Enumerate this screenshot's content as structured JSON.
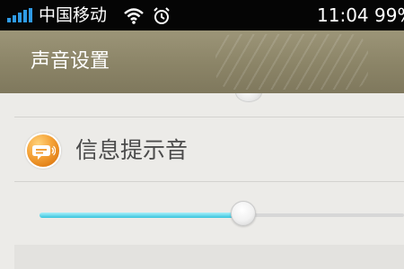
{
  "status_bar": {
    "carrier": "中国移动",
    "time": "11:04",
    "battery_percent": "99%",
    "signal_icon": "signal-bars-icon",
    "wifi_icon": "wifi-icon",
    "alarm_icon": "alarm-clock-icon"
  },
  "header": {
    "title": "声音设置"
  },
  "settings": {
    "message_tone": {
      "label": "信息提示音",
      "icon": "message-bubble-icon",
      "volume_fraction": 0.56
    }
  },
  "colors": {
    "status_bar_bg": "#050505",
    "header_bg": "#8b8467",
    "slider_fill": "#36c4dc",
    "icon_orange": "#f5a43a"
  }
}
